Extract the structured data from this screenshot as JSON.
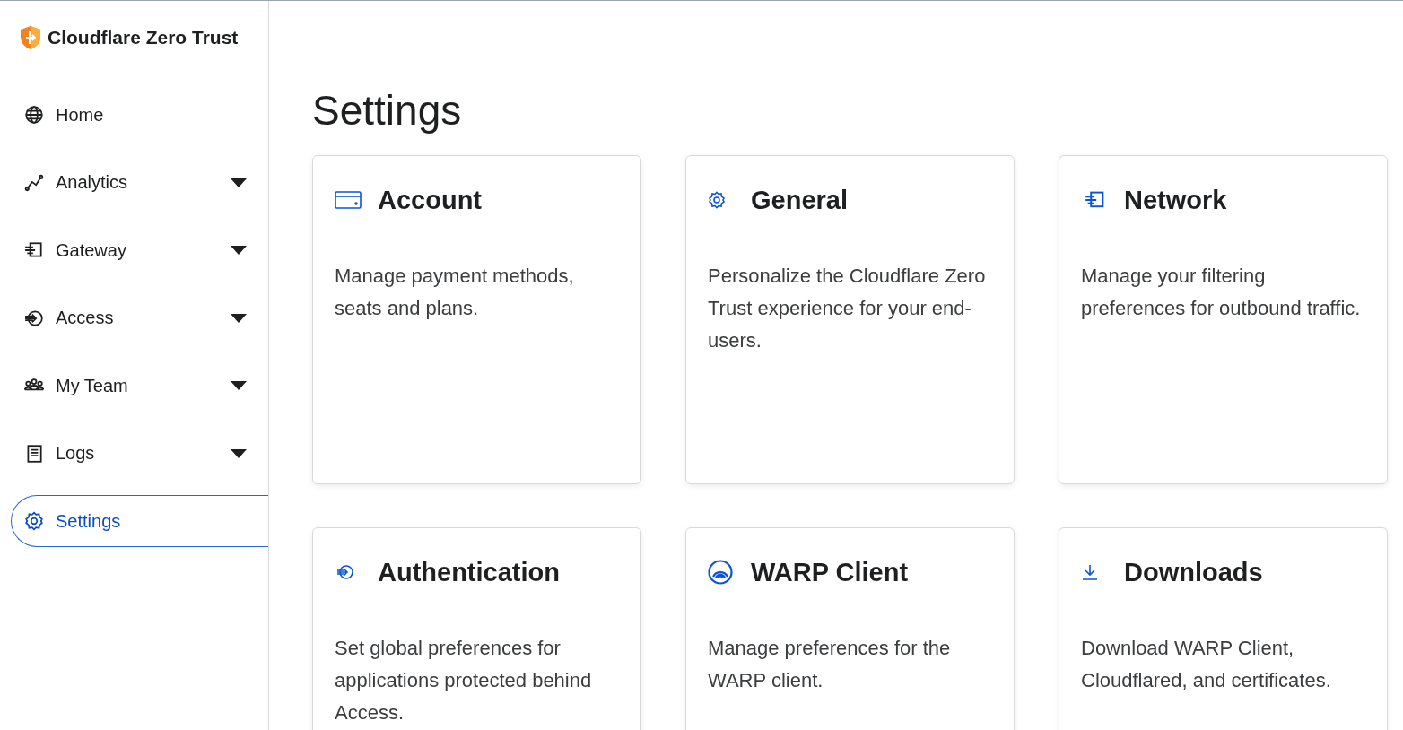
{
  "brand": {
    "name": "Cloudflare Zero Trust"
  },
  "sidebar": {
    "items": [
      {
        "label": "Home",
        "expandable": false,
        "selected": false
      },
      {
        "label": "Analytics",
        "expandable": true,
        "selected": false
      },
      {
        "label": "Gateway",
        "expandable": true,
        "selected": false
      },
      {
        "label": "Access",
        "expandable": true,
        "selected": false
      },
      {
        "label": "My Team",
        "expandable": true,
        "selected": false
      },
      {
        "label": "Logs",
        "expandable": true,
        "selected": false
      },
      {
        "label": "Settings",
        "expandable": false,
        "selected": true
      }
    ]
  },
  "page": {
    "title": "Settings"
  },
  "cards": [
    {
      "title": "Account",
      "description": "Manage payment methods, seats and plans."
    },
    {
      "title": "General",
      "description": "Personalize the Cloudflare Zero Trust experience for your end-users."
    },
    {
      "title": "Network",
      "description": "Manage your filtering preferences for outbound traffic."
    },
    {
      "title": "Authentication",
      "description": "Set global preferences for applications protected behind Access."
    },
    {
      "title": "WARP Client",
      "description": "Manage preferences for the WARP client."
    },
    {
      "title": "Downloads",
      "description": "Download WARP Client, Cloudflared, and certificates."
    }
  ]
}
